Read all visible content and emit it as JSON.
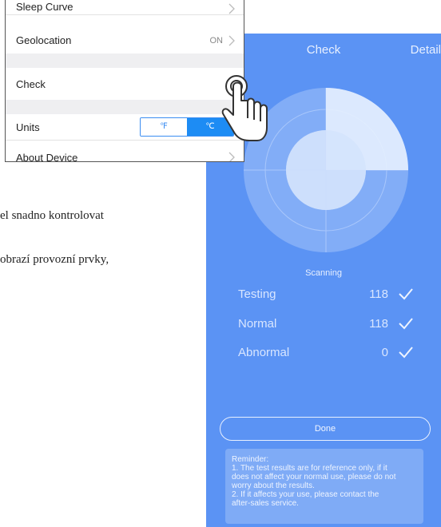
{
  "document": {
    "line1": "el snadno kontrolovat",
    "line2": "obrazí provozní prvky,"
  },
  "settings": {
    "rows": [
      {
        "label": "Sleep Curve"
      },
      {
        "label": "Geolocation",
        "value": "ON"
      },
      {
        "label": "Check"
      },
      {
        "label": "Units",
        "options": [
          "℉",
          "℃"
        ],
        "selected": "℃"
      },
      {
        "label": "About Device"
      }
    ]
  },
  "check_screen": {
    "title": "Check",
    "detail_label": "Detail",
    "status": "Scanning",
    "stats": [
      {
        "label": "Testing",
        "value": "118"
      },
      {
        "label": "Normal",
        "value": "118"
      },
      {
        "label": "Abnormal",
        "value": "0"
      }
    ],
    "done_label": "Done",
    "reminder": [
      "Reminder:",
      "1. The test results are for reference only, if it",
      "does not affect your normal use, please do not",
      "worry about the results.",
      "2. If it affects your use, please contact the",
      "after-sales service."
    ]
  },
  "colors": {
    "screen_bg": "#5b93f4",
    "accent": "#1d8cf4"
  },
  "icons": [
    "chevron-right-icon",
    "check-icon",
    "tap-hand-icon",
    "radar-icon"
  ]
}
